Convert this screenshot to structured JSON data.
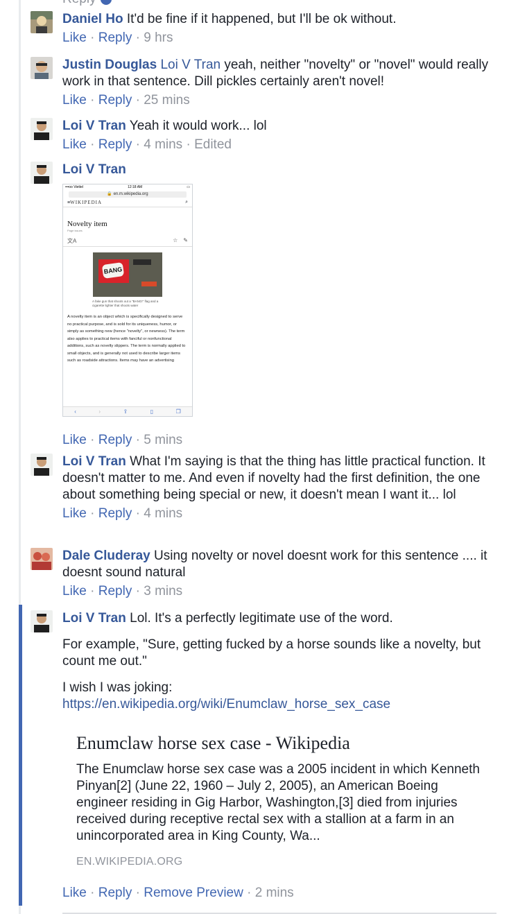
{
  "top_stub": {
    "text": "Reply"
  },
  "comments": [
    {
      "author": "Daniel Ho",
      "text": " It'd be fine if it happened, but I'll be ok without.",
      "like": "Like",
      "reply": "Reply",
      "time": "9 hrs"
    },
    {
      "author": "Justin Douglas",
      "mention": "Loi V Tran",
      "text": " yeah, neither \"novelty\" or \"novel\" would really work in that sentence. Dill pickles certainly aren't novel!",
      "like": "Like",
      "reply": "Reply",
      "time": "25 mins"
    },
    {
      "author": "Loi V Tran",
      "text": " Yeah it would work... lol",
      "like": "Like",
      "reply": "Reply",
      "time": "4 mins",
      "edited": "Edited"
    },
    {
      "author": "Loi V Tran",
      "like": "Like",
      "reply": "Reply",
      "time": "5 mins",
      "screenshot": {
        "carrier": "•••oo Viettel",
        "clock": "12:18 AM",
        "url": "en.m.wikipedia.org",
        "site": "WIKIPEDIA",
        "article_title": "Novelty item",
        "page_issues": "Page issues",
        "image_word": "BANG",
        "caption": "A fake gun that shoots out a \"BANG!\" flag and a cigarette lighter that shoots water",
        "article_text": "A novelty item is an object which is specifically designed to serve no practical purpose, and is sold for its uniqueness, humor, or simply as something new (hence \"novelty\", or newness). The term also applies to practical items with fanciful or nonfunctional additions, such as novelty slippers. The term is normally applied to small objects, and is generally not used to describe larger items such as roadside attractions. Items may have an advertising"
      }
    },
    {
      "author": "Loi V Tran",
      "text": " What I'm saying is that the thing has little practical function. It doesn't matter to me. And even if novelty had the first definition, the one about something being special or new, it doesn't mean I want it... lol",
      "like": "Like",
      "reply": "Reply",
      "time": "4 mins"
    },
    {
      "author": "Dale Cluderay",
      "text": " Using novelty or novel doesnt work for this sentence .... it doesnt sound natural",
      "like": "Like",
      "reply": "Reply",
      "time": "3 mins"
    },
    {
      "author": "Loi V Tran",
      "text": " Lol. It's a perfectly legitimate use of the word.",
      "para2": "For example, \"Sure, getting fucked by a horse sounds like a novelty, but count me out.\"",
      "para3": "I wish I was joking:",
      "url": "https://en.wikipedia.org/wiki/Enumclaw_horse_sex_case",
      "preview": {
        "title": "Enumclaw horse sex case - Wikipedia",
        "description": "The Enumclaw horse sex case was a 2005 incident in which Kenneth Pinyan[2] (June 22, 1960 – July 2, 2005), an American Boeing engineer residing in Gig Harbor, Washington,[3] died from injuries received during receptive rectal sex with a stallion at a farm in an unincorporated area in King County, Wa...",
        "domain": "EN.WIKIPEDIA.ORG"
      },
      "like": "Like",
      "reply": "Reply",
      "remove_preview": "Remove Preview",
      "time": "2 mins"
    }
  ],
  "colors": {
    "link": "#365899",
    "meta": "#90949c",
    "accent": "#4267b2"
  }
}
